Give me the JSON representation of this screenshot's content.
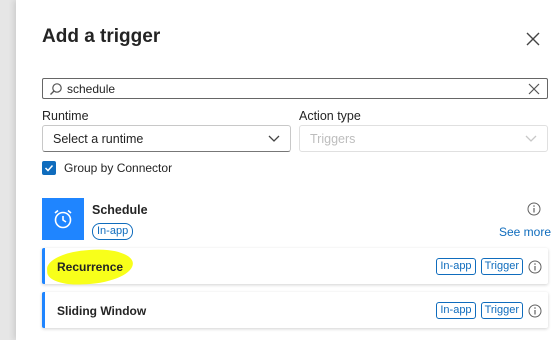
{
  "panel": {
    "title": "Add a trigger"
  },
  "search": {
    "value": "schedule"
  },
  "filters": {
    "runtime_label": "Runtime",
    "runtime_placeholder": "Select a runtime",
    "action_type_label": "Action type",
    "action_type_value": "Triggers"
  },
  "group_by": {
    "label": "Group by Connector",
    "checked": true
  },
  "connector": {
    "name": "Schedule",
    "badge": "In-app",
    "see_more": "See more",
    "icon": "alarm-clock-icon",
    "color": "#1f85ff"
  },
  "operations": [
    {
      "name": "Recurrence",
      "badge_runtime": "In-app",
      "badge_kind": "Trigger",
      "highlighted": true
    },
    {
      "name": "Sliding Window",
      "badge_runtime": "In-app",
      "badge_kind": "Trigger",
      "highlighted": false
    }
  ],
  "colors": {
    "accent": "#0f6cbd",
    "connector_blue": "#1f85ff",
    "highlight": "#f8ff1a"
  }
}
